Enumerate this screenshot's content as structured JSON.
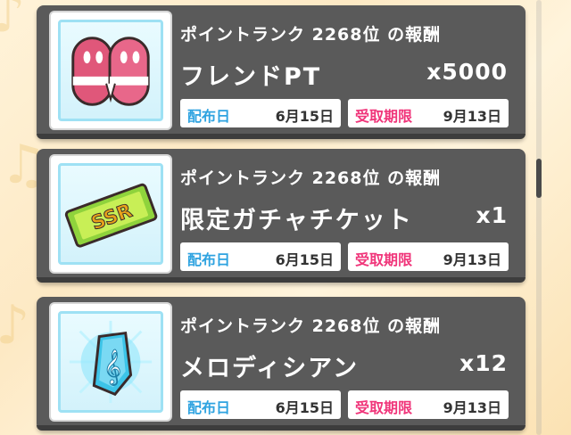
{
  "colors": {
    "card_bg": "#5a5a5a",
    "distribution_label": "#2fa3e0",
    "deadline_label": "#f0357a",
    "icon_border": "#9ee1f4"
  },
  "rewards": [
    {
      "rank_title": "ポイントランク 2268位 の報酬",
      "item_name": "フレンドPT",
      "quantity": "x5000",
      "distributed_label": "配布日",
      "distributed_date": "6月15日",
      "deadline_label": "受取期限",
      "deadline_date": "9月13日",
      "icon": "friend-pt-icon"
    },
    {
      "rank_title": "ポイントランク 2268位 の報酬",
      "item_name": "限定ガチャチケット",
      "quantity": "x1",
      "distributed_label": "配布日",
      "distributed_date": "6月15日",
      "deadline_label": "受取期限",
      "deadline_date": "9月13日",
      "icon": "ssr-ticket-icon"
    },
    {
      "rank_title": "ポイントランク 2268位 の報酬",
      "item_name": "メロディシアン",
      "quantity": "x12",
      "distributed_label": "配布日",
      "distributed_date": "6月15日",
      "deadline_label": "受取期限",
      "deadline_date": "9月13日",
      "icon": "melody-cyan-crystal-icon"
    }
  ],
  "ticket_badge": "SSR"
}
